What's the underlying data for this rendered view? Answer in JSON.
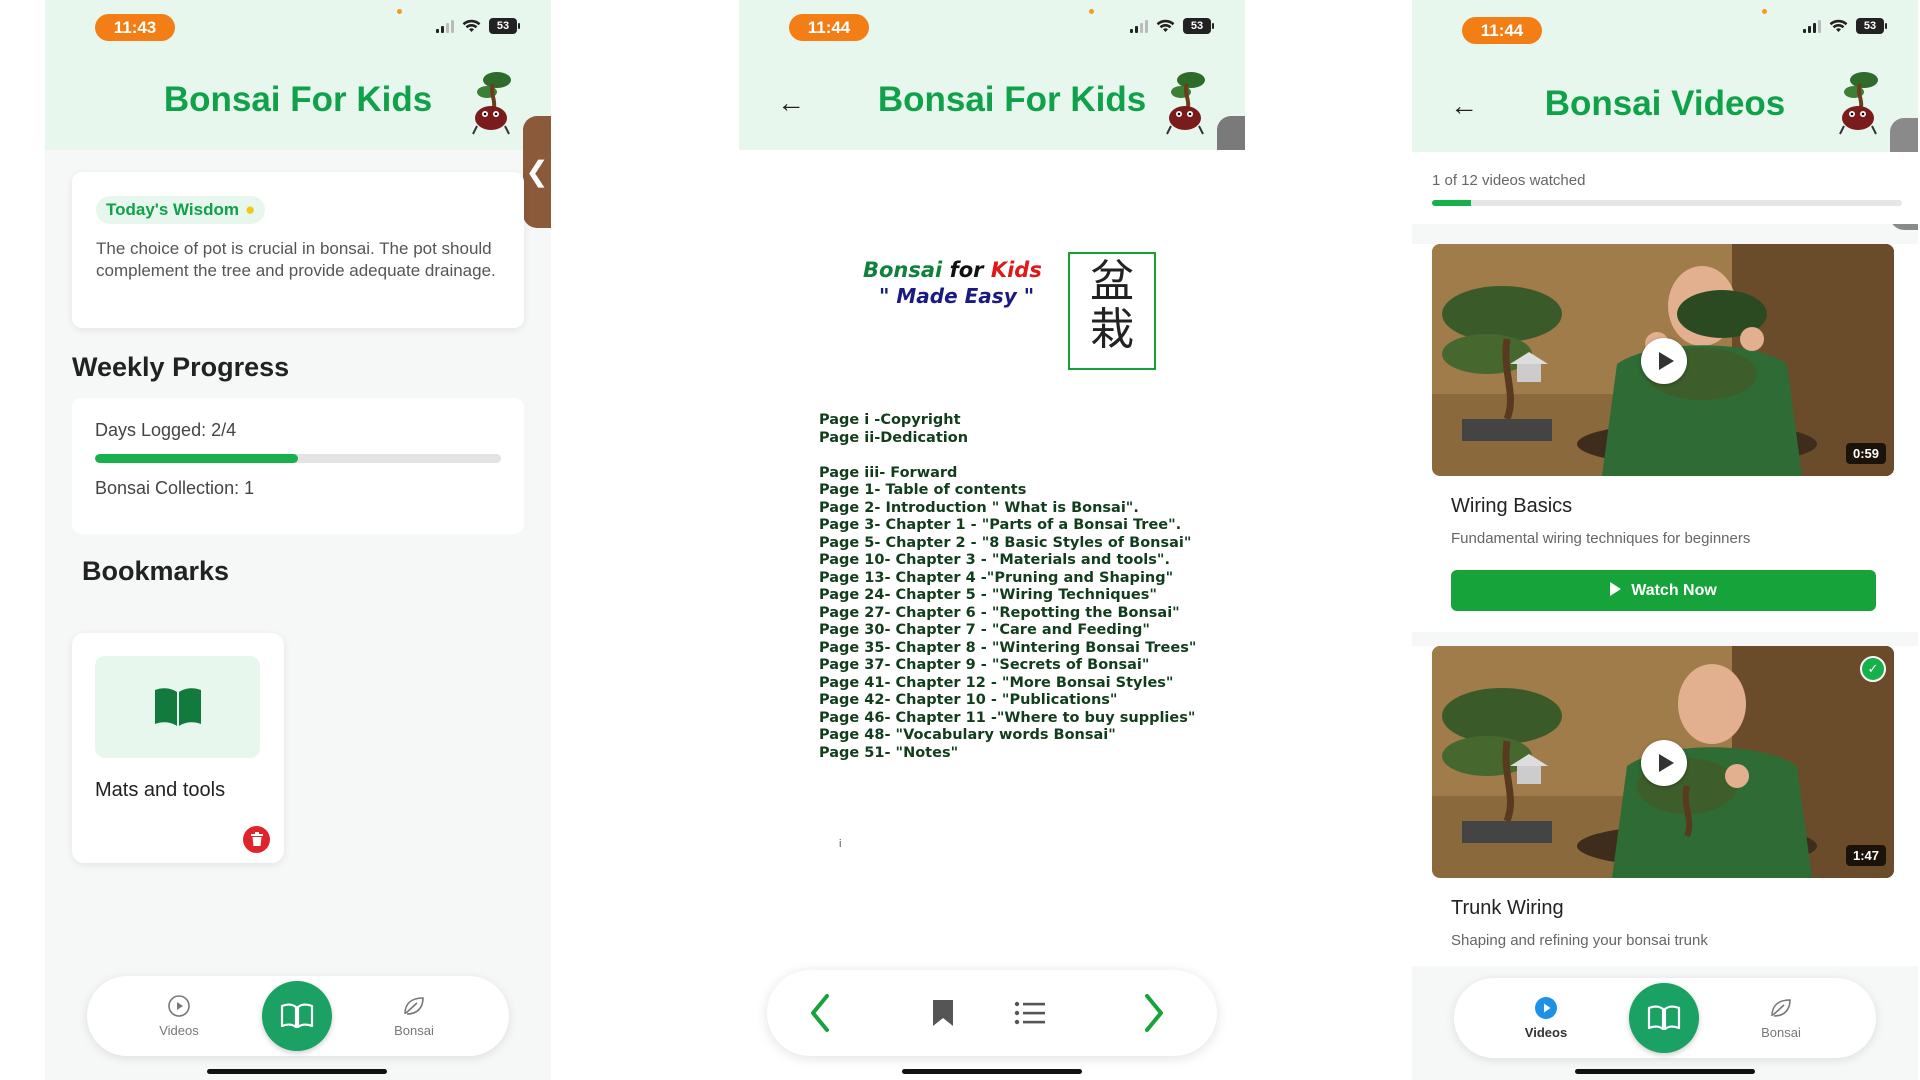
{
  "phone1": {
    "status_time": "11:43",
    "battery": "53",
    "title": "Bonsai For Kids",
    "side_tab_glyph": "❮",
    "wisdom": {
      "badge": "Today's Wisdom",
      "badge_icon": "lightbulb-icon",
      "text": "The choice of pot is crucial in bonsai. The pot should complement the tree and provide adequate drainage."
    },
    "weekly_progress": {
      "title": "Weekly Progress",
      "days_logged": "Days Logged: 2/4",
      "days_fraction": 0.5,
      "collection": "Bonsai Collection: 1"
    },
    "bookmarks": {
      "title": "Bookmarks",
      "items": [
        {
          "label": "Mats and tools",
          "icon": "open-book-icon"
        }
      ]
    },
    "nav": {
      "videos": "Videos",
      "bonsai": "Bonsai"
    }
  },
  "phone2": {
    "status_time": "11:44",
    "battery": "53",
    "title": "Bonsai For Kids",
    "book": {
      "title_parts": [
        "Bonsai",
        " for ",
        "Kids"
      ],
      "subtitle": "\" Made Easy \"",
      "kanji": [
        "盆",
        "栽"
      ],
      "toc": [
        "Page i -Copyright",
        "Page ii-Dedication",
        "",
        "Page iii- Forward",
        "Page 1- Table of contents",
        "Page 2- Introduction \" What is Bonsai\".",
        "Page 3- Chapter 1 - \"Parts of a Bonsai Tree\".",
        "Page 5- Chapter 2 - \"8 Basic Styles of Bonsai\"",
        "Page 10- Chapter 3 - \"Materials and tools\".",
        "Page 13- Chapter 4 -\"Pruning and Shaping\"",
        "Page 24- Chapter 5 - \"Wiring Techniques\"",
        "Page 27- Chapter 6 - \"Repotting the Bonsai\"",
        "Page 30- Chapter 7 - \"Care and Feeding\"",
        "Page 35- Chapter 8 - \"Wintering Bonsai Trees\"",
        "Page 37- Chapter  9 - \"Secrets of Bonsai\"",
        "Page 41- Chapter 12 - \"More Bonsai Styles\"",
        "Page 42- Chapter 10 - \"Publications\"",
        "Page 46- Chapter 11 -\"Where to buy supplies\"",
        "Page 48-  \"Vocabulary words Bonsai\"",
        "Page 51-     \"Notes\""
      ],
      "page_number": "i"
    }
  },
  "phone3": {
    "status_time": "11:44",
    "battery": "53",
    "title": "Bonsai Videos",
    "watched_text": "1 of 12 videos watched",
    "watched_fraction": 0.0833,
    "videos": [
      {
        "title": "Wiring Basics",
        "description": "Fundamental wiring techniques for beginners",
        "duration": "0:59",
        "button": "Watch Now",
        "watched": false
      },
      {
        "title": "Trunk Wiring",
        "description": "Shaping and refining your bonsai trunk",
        "duration": "1:47",
        "watched": true
      }
    ],
    "nav": {
      "videos": "Videos",
      "bonsai": "Bonsai"
    }
  },
  "colors": {
    "brand_green": "#10a14a",
    "header_bg": "#e8f7ee",
    "time_pill": "#f37e16",
    "nav_center": "#1aa163",
    "delete": "#e0252a",
    "video_active": "#1e90e6"
  }
}
